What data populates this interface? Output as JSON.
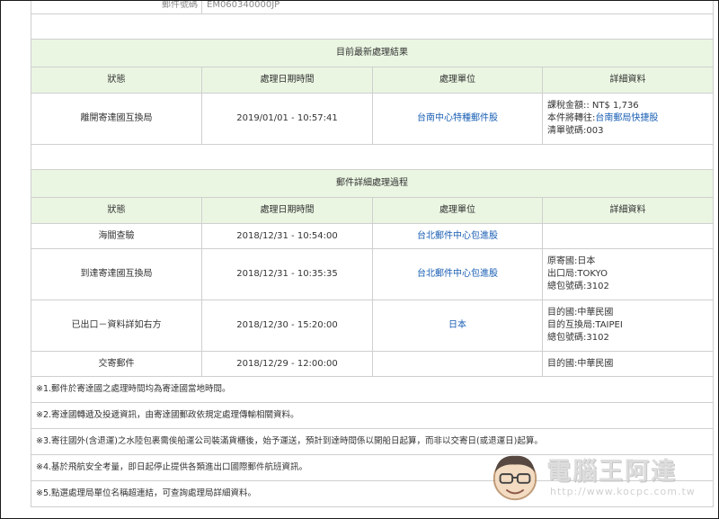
{
  "top_row": {
    "label": "郵件號碼",
    "value": "EM060340000JP"
  },
  "latest": {
    "caption": "目前最新處理結果",
    "headers": [
      "狀態",
      "處理日期時間",
      "處理單位",
      "詳細資料"
    ],
    "row": {
      "status": "離開寄達國互換局",
      "datetime": "2019/01/01 - 10:57:41",
      "unit": "台南中心特種郵件股",
      "details": [
        {
          "text": "課稅金額:: NT$ 1,736"
        },
        {
          "text": "本件將轉往:",
          "link": "台南郵局快捷股"
        },
        {
          "text": "清單號碼:003"
        }
      ]
    }
  },
  "history": {
    "caption": "郵件詳細處理過程",
    "headers": [
      "狀態",
      "處理日期時間",
      "處理單位",
      "詳細資料"
    ],
    "rows": [
      {
        "status": "海關查驗",
        "datetime": "2018/12/31 - 10:54:00",
        "unit": "台北郵件中心包進股",
        "details": []
      },
      {
        "status": "到達寄達國互換局",
        "datetime": "2018/12/31 - 10:35:35",
        "unit": "台北郵件中心包進股",
        "details": [
          "原寄國:日本",
          "出口局:TOKYO",
          "總包號碼:3102"
        ]
      },
      {
        "status": "已出口－資料詳如右方",
        "datetime": "2018/12/30 - 15:20:00",
        "unit": "日本",
        "details": [
          "目的國:中華民國",
          "目的互換局:TAIPEI",
          "總包號碼:3102"
        ]
      },
      {
        "status": "交寄郵件",
        "datetime": "2018/12/29 - 12:00:00",
        "unit": "",
        "details": [
          "目的國:中華民國"
        ]
      }
    ]
  },
  "notes": [
    "※1.郵件於寄達國之處理時間均為寄達國當地時間。",
    "※2.寄達國轉遞及投遞資訊，由寄達國郵政依規定處理傳輸相關資料。",
    "※3.寄往國外(含退運)之水陸包裹需俟船運公司裝滿貨櫃後，始予運送，預計到達時間係以開船日起算，而非以交寄日(或退運日)起算。",
    "※4.基於飛航安全考量，即日起停止提供各類進出口國際郵件航班資訊。",
    "※5.點選處理局單位名稱超連結，可查詢處理局詳細資料。"
  ],
  "watermark": {
    "title": "電腦王阿達",
    "url": "http://www.kocpc.com.tw"
  }
}
